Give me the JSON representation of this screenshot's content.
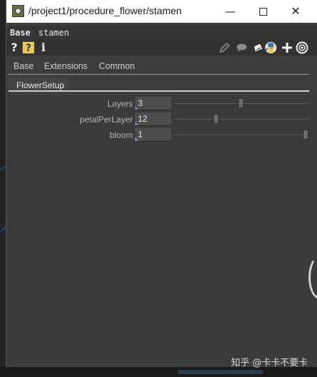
{
  "window": {
    "title": "/project1/procedure_flower/stamen",
    "controls": {
      "minimize": "—",
      "close": "✕"
    }
  },
  "op_header": {
    "comp_type": "Base",
    "op_name": "stamen"
  },
  "toolbar": {
    "help": "?",
    "python_help": "?",
    "info": "i",
    "icons": [
      "pencil-icon",
      "comment-icon",
      "clipboard-icon",
      "python-icon",
      "plus-icon",
      "target-icon"
    ]
  },
  "page_tabs": [
    "Base",
    "Extensions",
    "Common"
  ],
  "sub_tab": {
    "label": "FlowerSetup"
  },
  "parameters": [
    {
      "label": "Layers",
      "value": "3",
      "slider_fraction": 0.5
    },
    {
      "label": "petalPerLayer",
      "value": "12",
      "slider_fraction": 0.31
    },
    {
      "label": "bloom",
      "value": "1",
      "slider_fraction": 1.0
    }
  ],
  "watermark": "知乎 @卡卡不要卡",
  "colors": {
    "panel_bg": "#3d3d3d",
    "field_bg": "#4d4d4d",
    "field_marker": "#8b7ad6",
    "python_badge": "#f2c64a"
  }
}
